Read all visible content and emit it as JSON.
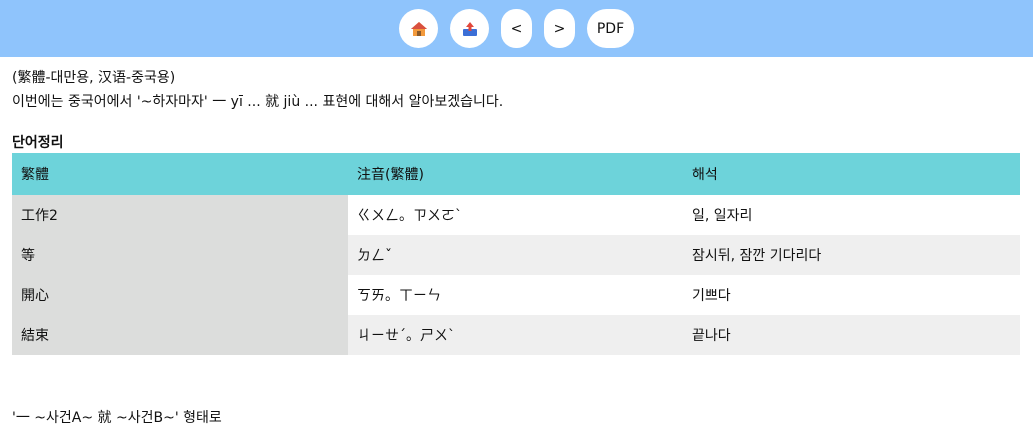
{
  "toolbar": {
    "home_icon": "home-icon",
    "upload_icon": "upload-inbox-icon",
    "prev_label": "<",
    "next_label": ">",
    "pdf_label": "PDF"
  },
  "intro": {
    "line1": "(繁體-대만용, 汉语-중국용)",
    "line2": "이번에는 중국어에서 '~하자마자' 一 yī ... 就 jiù ... 표현에 대해서 알아보겠습니다."
  },
  "vocab": {
    "title": "단어정리",
    "headers": [
      "繁體",
      "注音(繁體)",
      "해석"
    ],
    "rows": [
      [
        "工作2",
        "ㄍㄨㄥ。ㄗㄨㄛˋ",
        "일, 일자리"
      ],
      [
        "等",
        "ㄉㄥˇ",
        "잠시뒤, 잠깐 기다리다"
      ],
      [
        "開心",
        "ㄎㄞ。ㄒㄧㄣ",
        "기쁘다"
      ],
      [
        "結束",
        "ㄐㄧㄝˊ。ㄕㄨˋ",
        "끝나다"
      ]
    ]
  },
  "footer_line": "'一 ~사건A~ 就 ~사건B~' 형태로"
}
